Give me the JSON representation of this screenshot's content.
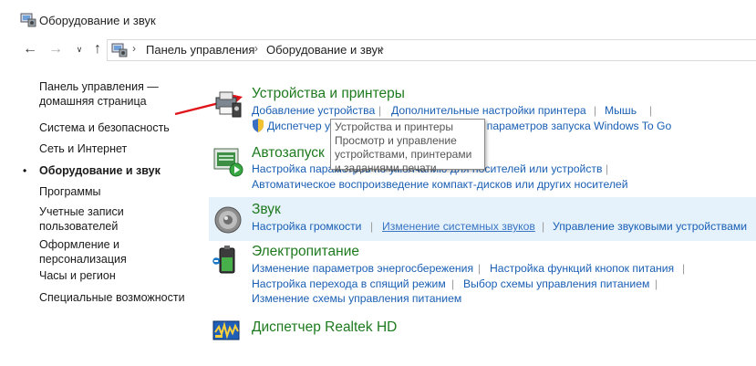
{
  "window": {
    "title": "Оборудование и звук"
  },
  "nav": {
    "back_icon": "back-arrow-icon",
    "forward_icon": "forward-arrow-icon",
    "recent_icon": "chevron-down-icon",
    "up_icon": "up-arrow-icon"
  },
  "breadcrumb": [
    "Панель управления",
    "Оборудование и звук"
  ],
  "sidebar": {
    "items": [
      {
        "label": "Панель управления —\nдомашняя страница"
      },
      {
        "label": "Система и безопасность"
      },
      {
        "label": "Сеть и Интернет"
      },
      {
        "label": "Оборудование и звук",
        "active": true
      },
      {
        "label": "Программы"
      },
      {
        "label": "Учетные записи\nпользователей"
      },
      {
        "label": "Оформление и\nперсонализация"
      },
      {
        "label": "Часы и регион"
      },
      {
        "label": "Специальные возможности"
      }
    ]
  },
  "categories": {
    "devices": {
      "title": "Устройства и принтеры",
      "links": [
        "Добавление устройства",
        "Дополнительные настройки принтера",
        "Мышь",
        "Диспетчер устройств",
        "Изменение параметров запуска Windows To Go"
      ]
    },
    "autoplay": {
      "title": "Автозапуск",
      "links": [
        "Настройка параметров по умолчанию для носителей или устройств",
        "Автоматическое воспроизведение компакт-дисков или других носителей"
      ]
    },
    "sound": {
      "title": "Звук",
      "links": [
        "Настройка громкости",
        "Изменение системных звуков",
        "Управление звуковыми устройствами"
      ]
    },
    "power": {
      "title": "Электропитание",
      "links": [
        "Изменение параметров энергосбережения",
        "Настройка функций кнопок питания",
        "Настройка перехода в спящий режим",
        "Выбор схемы управления питанием",
        "Изменение схемы управления питанием"
      ]
    },
    "realtek": {
      "title": "Диспетчер Realtek HD"
    }
  },
  "tooltip": {
    "title": "Устройства и принтеры",
    "body": "Просмотр и управление устройствами, принтерами и заданиями печати"
  },
  "colors": {
    "link": "#1a5fb4",
    "category": "#1e7a1e",
    "highlight": "#e5f1fb",
    "arrow": "#e0151b"
  }
}
